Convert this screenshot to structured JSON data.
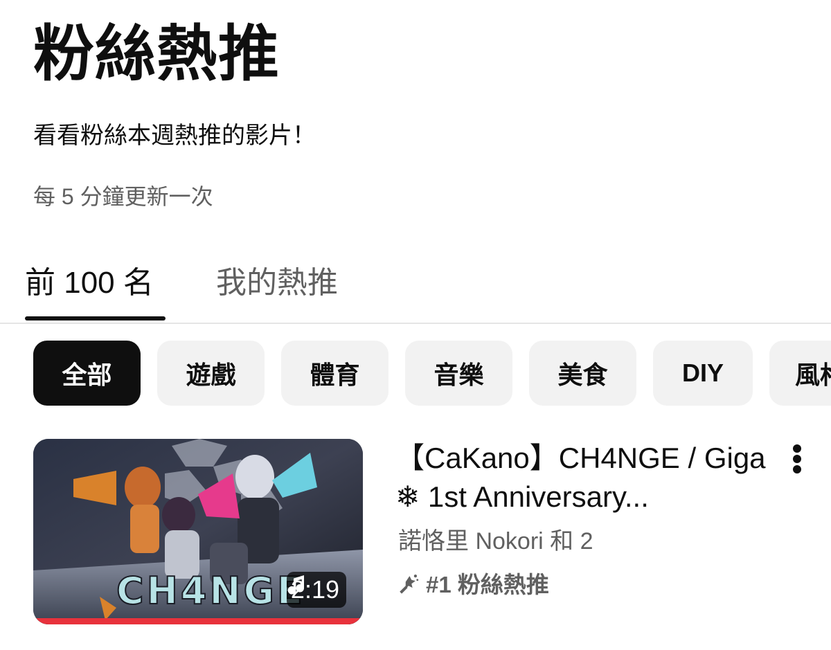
{
  "header": {
    "title": "粉絲熱推",
    "subtitle": "看看粉絲本週熱推的影片！",
    "update_note": "每 5 分鐘更新一次"
  },
  "tabs": [
    {
      "label": "前 100 名",
      "selected": true
    },
    {
      "label": "我的熱推",
      "selected": false
    }
  ],
  "chips": [
    {
      "label": "全部",
      "selected": true
    },
    {
      "label": "遊戲",
      "selected": false
    },
    {
      "label": "體育",
      "selected": false
    },
    {
      "label": "音樂",
      "selected": false
    },
    {
      "label": "美食",
      "selected": false
    },
    {
      "label": "DIY",
      "selected": false
    },
    {
      "label": "風格",
      "selected": false
    }
  ],
  "videos": [
    {
      "title": "【CaKano】CH4NGE / Giga ❄ 1st Anniversary...",
      "channel": "諾恪里 Nokori 和 2",
      "rank_text": "#1 粉絲熱推",
      "duration": "2:19",
      "thumbnail_text": "CH4NGE",
      "watched_fraction": 1.0,
      "icons": [
        "music-note-icon",
        "rank-shoutout-icon",
        "more-vert-icon"
      ]
    }
  ],
  "colors": {
    "selected_chip_bg": "#0f0f0f",
    "chip_bg": "#f2f2f2",
    "secondary_text": "#606060",
    "progress_red": "#e8323c"
  }
}
